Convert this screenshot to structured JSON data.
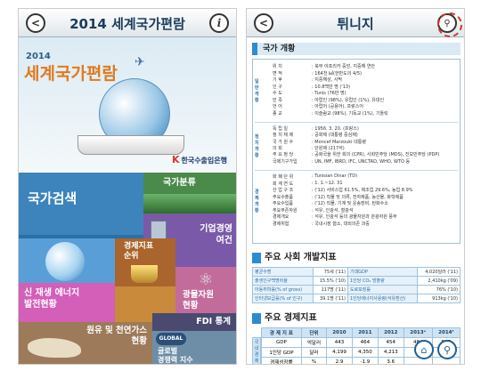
{
  "left": {
    "header": {
      "title": "2014 세계국가편람",
      "back": "<",
      "info": "i"
    },
    "banner": {
      "year": "2014",
      "title": "세계국가편람",
      "bank": "한국수출입은행",
      "bank_sub": "The Export-Import Bank of Korea"
    },
    "tiles": {
      "search": "국가검색",
      "category": "국가분류",
      "biz": [
        "기업경영",
        "여건"
      ],
      "econ_rank": [
        "경제지표",
        "순위"
      ],
      "renew": [
        "신 재생 에너지",
        "발전현황"
      ],
      "mineral": [
        "광물자원",
        "현황"
      ],
      "oil": [
        "원유 및 천연가스",
        "현황"
      ],
      "fdi": "FDI 통계",
      "global": [
        "글로벌",
        "경쟁력 지수"
      ],
      "global_logo": "GLOBAL"
    }
  },
  "right": {
    "header": {
      "title": "튀니지",
      "back": "<",
      "loc_icon": "location-pin-icon"
    },
    "sec1": {
      "title": "국가 개황",
      "groups": [
        {
          "label": [
            "일",
            "반",
            "개",
            "황"
          ],
          "rows": [
            [
              "위    치",
              ": 북부 아프리카 중앙, 지중해 연안"
            ],
            [
              "면    적",
              ": 164천 ㎢(한반도의 4/5)"
            ],
            [
              "기    후",
              ": 지중해성, 사막"
            ],
            [
              "인    구",
              ": 10.8백만 명 ('13)"
            ],
            [
              "수    도",
              ": Tunis (76만 명)"
            ],
            [
              "민    족",
              ": 아랍인 (98%), 유럽인 (1%), 유대인"
            ],
            [
              "언    어",
              ": 아랍어 (공용어), 프랑스어"
            ],
            [
              "종    교",
              ": 이슬람교 (98%), 기독교 (1%), 기톨릭"
            ]
          ]
        },
        {
          "label": [
            "정",
            "치",
            "개",
            "황"
          ],
          "rows": [
            [
              "독 립 일",
              ": 1956. 3. 20. (프랑스)"
            ],
            [
              "정 치 체 제",
              ": 공화제 (대통령 중심제)"
            ],
            [
              "국 가 원 수",
              ": Moncef Marzouki 대통령"
            ],
            [
              "의    회",
              ": 단원제 (217석)"
            ],
            [
              "주 요 정 당",
              ": 공화국을 위한 회의 (CPR), 사회민주당 (MDS), 진보민주당 (PDP)"
            ],
            [
              "국제기구가입",
              ": UN, IMF, IBRD, IFC, UNCTAD, WHO, WTO 등"
            ]
          ]
        },
        {
          "label": [
            "경",
            "제",
            "개",
            "황"
          ],
          "rows": [
            [
              "화 폐 단 위",
              ": Tunisian Dinar (TD)"
            ],
            [
              "회 계 연 도",
              ": 1. 1.~12. 31"
            ],
            [
              "산 업 구 조",
              ": ('12) 서비스업 61.5%, 제조업 29.6%, 농업 8.9%"
            ],
            [
              "주요수출품",
              ": ('12) 직물 및 의류, 전자제품, 농산물, 화학제품"
            ],
            [
              "주요수입품",
              ": ('12) 직물, 기계 및 운송장비, 탄화수소"
            ],
            [
              "주요부존자원",
              ": 석유, 인광석, 철광석"
            ],
            [
              "경제개요",
              ": 석유, 인광석 등의 광물자원과 관광자원 풍부"
            ],
            [
              "경제위험",
              ": 국내시장 협소, 대외의존 과중"
            ]
          ]
        }
      ]
    },
    "sec2": {
      "title": "주요 사회 개발지표",
      "rows": [
        [
          "평균수명",
          "75세 ('11)",
          "기대GDP",
          "4,020달러 ('11)"
        ],
        [
          "출생인구백명비율",
          "15.5% ('10)",
          "1인당 CO₂ 방출량",
          "2,410kg ('09)"
        ],
        [
          "아동취학률(% of gross)",
          "117명 ('11)",
          "도로포장률",
          "76% ('10)"
        ],
        [
          "인터넷보급률(% of 인구)",
          "39.1명 ('11)",
          "1인당에너지사용량(석유환산)",
          "913kg ('10)"
        ]
      ]
    },
    "sec3": {
      "title": "주요 경제지표",
      "headers": [
        "경 제 지 표",
        "단위",
        "2010",
        "2011",
        "2012",
        "2013ᵉ",
        "2014ᶠ"
      ],
      "rows": [
        [
          "GDP",
          "억달러",
          "443",
          "464",
          "454",
          "484",
          "515"
        ],
        [
          "1인당 GDP",
          "달러",
          "4,199",
          "4,350",
          "4,213",
          "",
          ""
        ],
        [
          "경제성장률",
          "%",
          "2.9",
          "-1.9",
          "3.6",
          "",
          ""
        ]
      ],
      "side_label": [
        "국",
        "내",
        "경",
        "제"
      ]
    },
    "fab": {
      "home": "home-icon",
      "search": "search-icon"
    }
  }
}
